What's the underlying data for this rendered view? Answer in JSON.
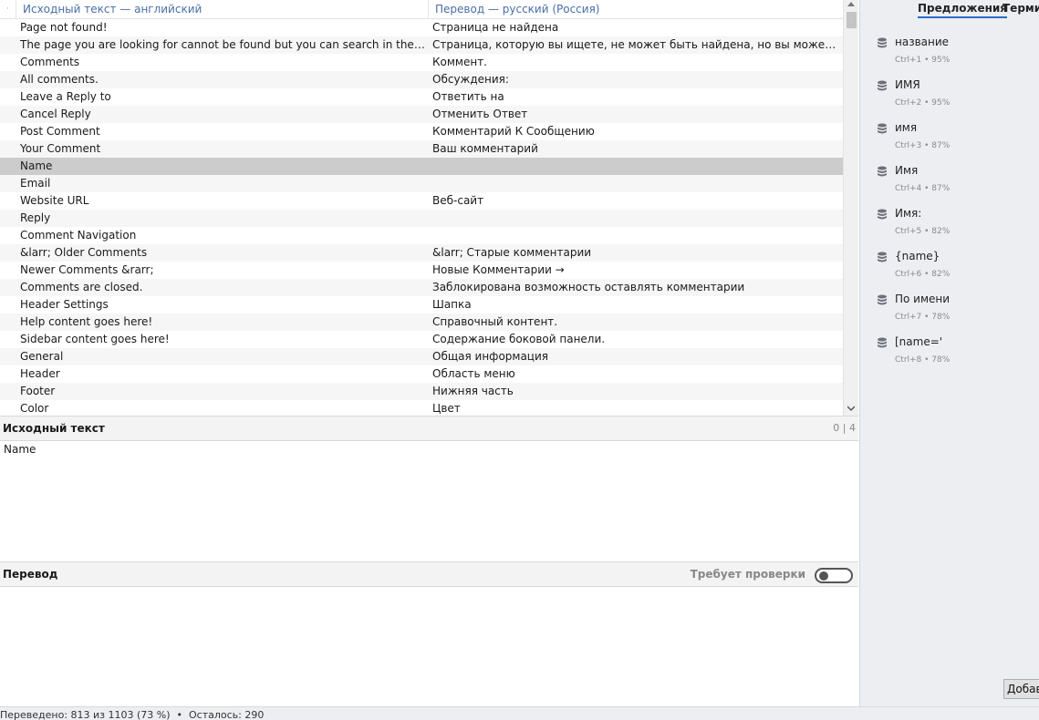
{
  "grid": {
    "headers": {
      "marker": "·",
      "source": "Исходный текст — английский",
      "target": "Перевод — русский (Россия)"
    },
    "rows": [
      {
        "source": "Page not found!",
        "target": "Страница не найдена"
      },
      {
        "source": "The page you are looking for cannot be found but you can search in the site with s...",
        "target": "Страница, которую вы ищете, не может быть найдена, но вы можете искать на..."
      },
      {
        "source": "Comments",
        "target": "Коммент."
      },
      {
        "source": "All comments.",
        "target": "Обсуждения:"
      },
      {
        "source": "Leave a Reply to",
        "target": "Ответить на"
      },
      {
        "source": "Cancel Reply",
        "target": "Отменить Ответ"
      },
      {
        "source": "Post Comment",
        "target": "Комментарий К Сообщению"
      },
      {
        "source": "Your Comment",
        "target": "Ваш комментарий"
      },
      {
        "source": "Name",
        "target": ""
      },
      {
        "source": "Email",
        "target": ""
      },
      {
        "source": "Website URL",
        "target": "Веб-сайт"
      },
      {
        "source": "Reply",
        "target": ""
      },
      {
        "source": "Comment Navigation",
        "target": ""
      },
      {
        "source": "&larr; Older Comments",
        "target": "&larr; Старые комментарии"
      },
      {
        "source": "Newer Comments &rarr;",
        "target": "Новые Комментарии →"
      },
      {
        "source": "Comments are closed.",
        "target": "Заблокирована возможность оставлять комментарии"
      },
      {
        "source": "Header Settings",
        "target": "Шапка"
      },
      {
        "source": "Help content goes here!",
        "target": "Справочный контент."
      },
      {
        "source": "Sidebar content goes here!",
        "target": "Содержание боковой панели."
      },
      {
        "source": "General",
        "target": "Общая информация"
      },
      {
        "source": "Header",
        "target": "Область меню"
      },
      {
        "source": "Footer",
        "target": "Нижняя часть"
      },
      {
        "source": "Color",
        "target": "Цвет"
      }
    ],
    "selected_index": 8
  },
  "source_panel": {
    "title": "Исходный текст",
    "counter": "0 | 4",
    "text": "Name"
  },
  "translation_panel": {
    "title": "Перевод",
    "needs_review_label": "Требует проверки",
    "needs_review_on": false,
    "text": ""
  },
  "side_panel": {
    "tabs": [
      "Предложения",
      "Термины"
    ],
    "active_tab": 0,
    "suggestions": [
      {
        "text": "название",
        "meta": "Ctrl+1 • 95%"
      },
      {
        "text": "ИМЯ",
        "meta": "Ctrl+2 • 95%"
      },
      {
        "text": "имя",
        "meta": "Ctrl+3 • 87%"
      },
      {
        "text": "Имя",
        "meta": "Ctrl+4 • 87%"
      },
      {
        "text": "Имя:",
        "meta": "Ctrl+5 • 82%"
      },
      {
        "text": "{name}",
        "meta": "Ctrl+6 • 82%"
      },
      {
        "text": "По имени",
        "meta": "Ctrl+7 • 78%"
      },
      {
        "text": "[name='",
        "meta": "Ctrl+8 • 78%"
      }
    ],
    "add_button": "Добавить"
  },
  "status": {
    "text": "Переведено: 813 из 1103 (73 %)  •  Осталось: 290"
  },
  "colors": {
    "header_text": "#4a6fa5",
    "selected_row": "#cccccc",
    "side_bg": "#eceef2",
    "tab_underline": "#2b6cc4"
  }
}
